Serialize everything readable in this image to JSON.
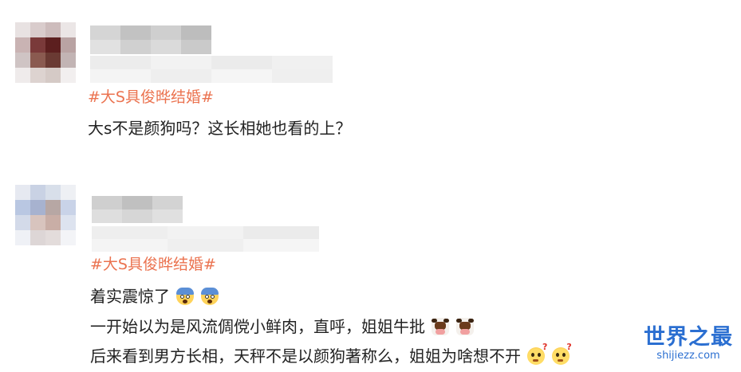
{
  "accent_color": "#eb7350",
  "comments": [
    {
      "hashtag": "#大S具俊晔结婚#",
      "lines": [
        {
          "text": "大s不是颜狗吗？这长相她也看的上？",
          "emojis": []
        }
      ]
    },
    {
      "hashtag": "#大S具俊晔结婚#",
      "lines": [
        {
          "text": "着实震惊了",
          "emojis": [
            "shocked-face-icon",
            "shocked-face-icon"
          ]
        },
        {
          "text": "一开始以为是风流倜傥小鲜肉，直呼，姐姐牛批",
          "emojis": [
            "cow-face-icon",
            "cow-face-icon"
          ]
        },
        {
          "text": "后来看到男方长相，天秤不是以颜狗著称么，姐姐为啥想不开",
          "emojis": [
            "thinking-face-icon",
            "thinking-face-icon"
          ]
        }
      ]
    }
  ],
  "watermark": {
    "main": "世界之最",
    "sub": "shijiezz.com"
  }
}
